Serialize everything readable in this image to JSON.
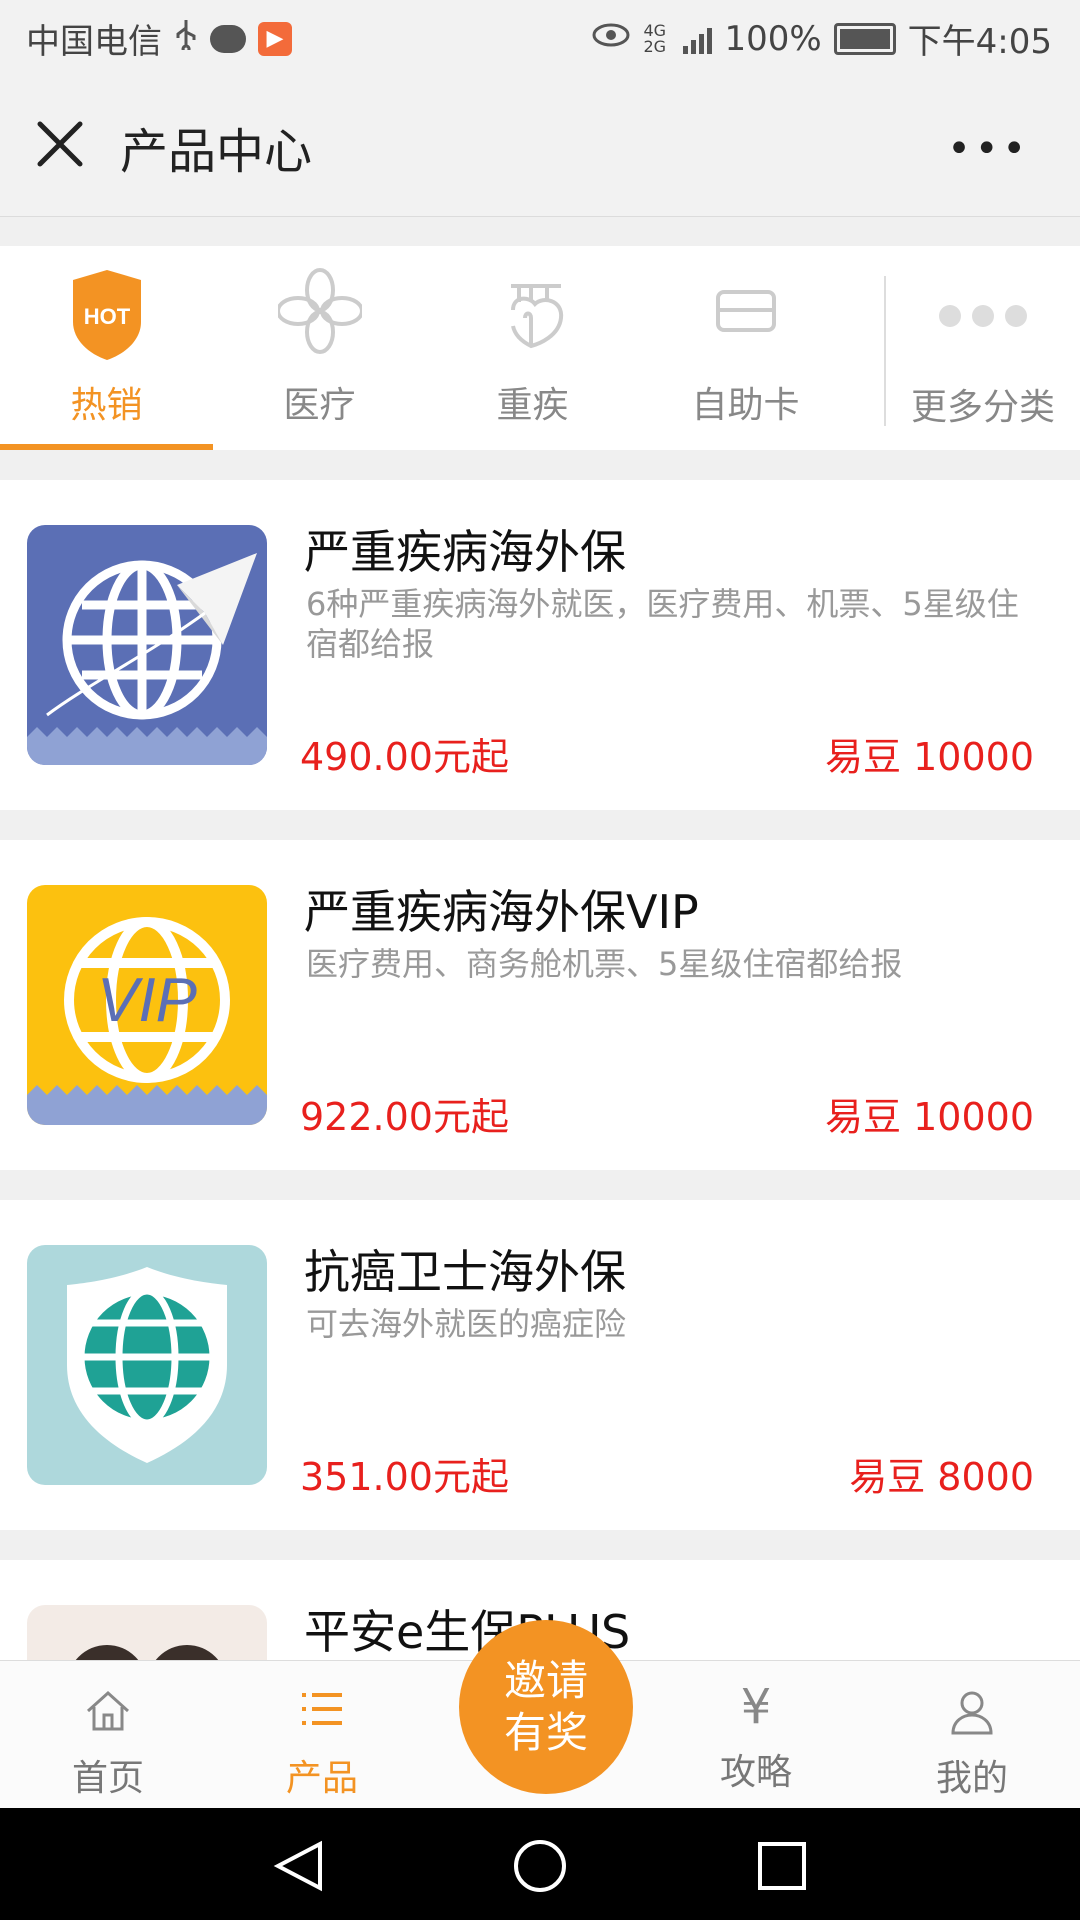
{
  "status_bar": {
    "carrier": "中国电信",
    "network": "4G 2G",
    "battery": "100%",
    "time": "下午4:05"
  },
  "header": {
    "title": "产品中心",
    "close_icon": "close-icon",
    "more_label": "•••"
  },
  "tabs": [
    {
      "label": "热销",
      "icon": "hot-icon",
      "hot_text": "HOT"
    },
    {
      "label": "医疗",
      "icon": "medical-icon"
    },
    {
      "label": "重疾",
      "icon": "critical-illness-icon"
    },
    {
      "label": "自助卡",
      "icon": "card-icon"
    },
    {
      "label": "更多分类",
      "icon": "more-dots-icon"
    }
  ],
  "products": [
    {
      "name": "严重疾病海外保",
      "desc": "6种严重疾病海外就医，医疗费用、机票、5星级住宿都给报",
      "price": "490.00元起",
      "beans": "易豆 10000",
      "thumb_color": "#5b6fb5"
    },
    {
      "name": "严重疾病海外保VIP",
      "desc": "医疗费用、商务舱机票、5星级住宿都给报",
      "price": "922.00元起",
      "beans": "易豆 10000",
      "thumb_color": "#fcc10f",
      "thumb_text": "VIP"
    },
    {
      "name": "抗癌卫士海外保",
      "desc": "可去海外就医的癌症险",
      "price": "351.00元起",
      "beans": "易豆 8000",
      "thumb_color": "#aed8dc"
    },
    {
      "name": "平安e生保PLUS",
      "desc": "",
      "price": "",
      "beans": ""
    }
  ],
  "bottom_nav": {
    "home": "首页",
    "products": "产品",
    "invite_line1": "邀请",
    "invite_line2": "有奖",
    "guide": "攻略",
    "guide_symbol": "¥",
    "mine": "我的"
  },
  "colors": {
    "accent": "#f39323",
    "price": "#e8201d"
  }
}
